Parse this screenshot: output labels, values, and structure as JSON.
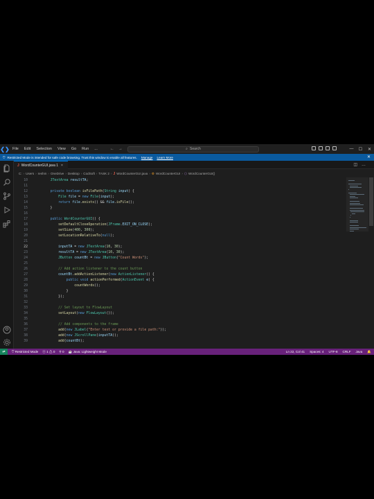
{
  "title_bar": {
    "menus": [
      "File",
      "Edit",
      "Selection",
      "View",
      "Go",
      "Run",
      "..."
    ],
    "search_placeholder": "Search"
  },
  "banner": {
    "message": "Restricted Mode is intended for safe code browsing. Trust this window to enable all features.",
    "manage_label": "Manage",
    "learn_more_label": "Learn More"
  },
  "tab": {
    "icon": "J",
    "label": "WordCounterGUI.java 1",
    "close": "×"
  },
  "breadcrumb": [
    "C:",
    "Users",
    "reshm",
    "OneDrive",
    "Desktop",
    "CodSoft",
    "TASK 2",
    "WordCounterGUI.java",
    "WordCounterGUI",
    "WordCounterGUI()"
  ],
  "editor": {
    "current_line": "22",
    "lines": [
      {
        "n": "10",
        "code": "    JTextArea resultTA;"
      },
      {
        "n": "11",
        "code": ""
      },
      {
        "n": "12",
        "code": "    private boolean isFilePath(String input) {"
      },
      {
        "n": "13",
        "code": "        File file = new File(input);"
      },
      {
        "n": "14",
        "code": "        return file.exists() && file.isFile();"
      },
      {
        "n": "15",
        "code": "    }"
      },
      {
        "n": "16",
        "code": ""
      },
      {
        "n": "17",
        "code": "    public WordCounterGUI() {"
      },
      {
        "n": "18",
        "code": "        setDefaultCloseOperation(JFrame.EXIT_ON_CLOSE);"
      },
      {
        "n": "19",
        "code": "        setSize(400, 300);"
      },
      {
        "n": "20",
        "code": "        setLocationRelativeTo(null);"
      },
      {
        "n": "21",
        "code": ""
      },
      {
        "n": "22",
        "code": "        inputTA = new JTextArea(10, 30);"
      },
      {
        "n": "23",
        "code": "        resultTA = new JTextArea(10, 30);"
      },
      {
        "n": "24",
        "code": "        JButton countBt = new JButton(\"Count Words\");"
      },
      {
        "n": "25",
        "code": ""
      },
      {
        "n": "26",
        "code": "        // Add action listener to the count button"
      },
      {
        "n": "27",
        "code": "        countBt.addActionListener(new ActionListener() {"
      },
      {
        "n": "28",
        "code": "            public void actionPerformed(ActionEvent e) {"
      },
      {
        "n": "29",
        "code": "                countWords();"
      },
      {
        "n": "30",
        "code": "            }"
      },
      {
        "n": "31",
        "code": "        });"
      },
      {
        "n": "32",
        "code": ""
      },
      {
        "n": "33",
        "code": "        // Set layout to FlowLayout"
      },
      {
        "n": "34",
        "code": "        setLayout(new FlowLayout());"
      },
      {
        "n": "35",
        "code": ""
      },
      {
        "n": "36",
        "code": "        // Add components to the frame"
      },
      {
        "n": "37",
        "code": "        add(new JLabel(\"Enter text or provide a file path:\"));"
      },
      {
        "n": "38",
        "code": "        add(new JScrollPane(inputTA));"
      },
      {
        "n": "39",
        "code": "        add(countBt);"
      }
    ]
  },
  "status_bar": {
    "restricted": "Restricted Mode",
    "errors": "1",
    "warnings": "0",
    "ports": "0",
    "java_status": "Java: Lightweight Mode",
    "position": "Ln 22, Col 41",
    "spaces": "Spaces: 4",
    "encoding": "UTF-8",
    "eol": "CRLF",
    "language": "Java"
  },
  "colors": {
    "status_bar": "#68217a",
    "banner": "#0a5a9e",
    "editor_bg": "#1e1e1e"
  }
}
